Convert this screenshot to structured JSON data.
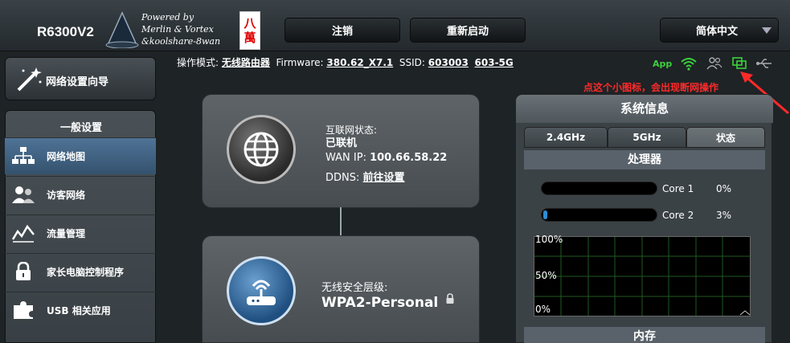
{
  "header": {
    "model": "R6300V2",
    "logo_lines": [
      "Powered by",
      "Merlin & Vortex",
      "&koolshare-8wan"
    ],
    "badge_lines": [
      "八",
      "萬"
    ],
    "logout_label": "注销",
    "reboot_label": "重新启动",
    "language": "简体中文"
  },
  "status_bar": {
    "mode_label": "操作模式:",
    "mode_value": "无线路由器",
    "firmware_label": "Firmware:",
    "firmware_value": "380.62_X7.1",
    "ssid_label": "SSID:",
    "ssid_1": "603003",
    "ssid_2": "603-5G",
    "app_label": "App"
  },
  "annotation": "点这个小图标，会出现断网操作",
  "sidebar": {
    "wizard_label": "网络设置向导",
    "section_title": "一般设置",
    "items": [
      {
        "label": "网络地图",
        "icon": "network-map-icon"
      },
      {
        "label": "访客网络",
        "icon": "guest-network-icon"
      },
      {
        "label": "流量管理",
        "icon": "traffic-icon"
      },
      {
        "label": "家长电脑控制程序",
        "icon": "parental-lock-icon"
      },
      {
        "label": "USB 相关应用",
        "icon": "usb-puzzle-icon"
      }
    ]
  },
  "internet": {
    "status_label": "互联网状态:",
    "status_value": "已联机",
    "wan_label": "WAN IP:",
    "wan_ip": "100.66.58.22",
    "ddns_label": "DDNS:",
    "ddns_link": "前往设置"
  },
  "wireless": {
    "security_label": "无线安全层级:",
    "security_value": "WPA2-Personal"
  },
  "system_info": {
    "title": "系统信息",
    "tabs": [
      "2.4GHz",
      "5GHz",
      "状态"
    ],
    "active_tab": 2,
    "cpu_title": "处理器",
    "cores": [
      {
        "name": "Core 1",
        "percent": "0%",
        "level": 0
      },
      {
        "name": "Core 2",
        "percent": "3%",
        "level": 3
      }
    ],
    "graph_labels": [
      "100%",
      "50%",
      "0%"
    ],
    "memory_title": "内存"
  }
}
